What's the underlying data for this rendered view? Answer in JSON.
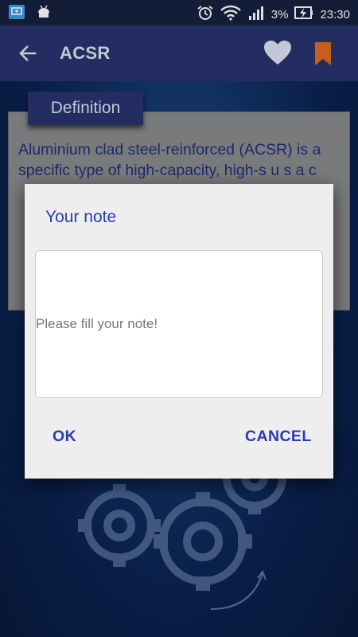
{
  "status_bar": {
    "battery_percent": "3%",
    "time": "23:30"
  },
  "app_bar": {
    "title": "ACSR",
    "accent_color": "#2a3470",
    "bookmark_color": "#e46b1f"
  },
  "definition": {
    "tab_label": "Definition",
    "text": "Aluminium clad steel-reinforced (ACSR) is a specific type of high-capacity, high-s u s a c"
  },
  "dialog": {
    "title": "Your note",
    "note_placeholder": "Please fill your note!",
    "ok_label": "OK",
    "cancel_label": "CANCEL"
  }
}
